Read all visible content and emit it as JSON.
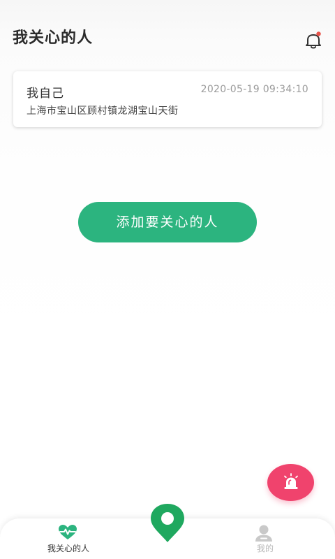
{
  "header": {
    "title": "我关心的人",
    "notification_icon": "bell-icon"
  },
  "card": {
    "name": "我自己",
    "timestamp": "2020-05-19 09:34:10",
    "address": "上海市宝山区顾村镇龙湖宝山天街"
  },
  "actions": {
    "add_label": "添加要关心的人",
    "sos_icon": "alarm-siren-icon"
  },
  "tabbar": {
    "tabs": [
      {
        "label": "我关心的人",
        "icon": "heart-pulse-icon",
        "active": true
      },
      {
        "label": "",
        "icon": "location-pin-icon",
        "active": false
      },
      {
        "label": "我的",
        "icon": "user-icon",
        "active": false
      }
    ]
  },
  "colors": {
    "brand_green": "#2cb47f",
    "sos_red": "#f0436d",
    "notification_dot": "#e8534a"
  }
}
